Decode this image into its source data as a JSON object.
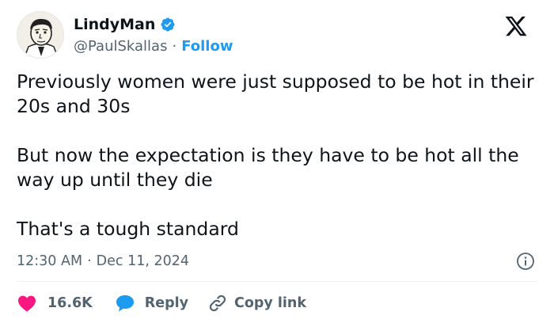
{
  "author": {
    "display_name": "LindyMan",
    "handle": "@PaulSkallas",
    "separator": "·",
    "follow_label": "Follow",
    "verified": true
  },
  "tweet": {
    "paragraphs": [
      "Previously women were just supposed to be hot in their 20s and 30s",
      "But now the expectation is they have to be hot all the way up until they die",
      "That's a tough standard"
    ]
  },
  "meta": {
    "time": "12:30 AM",
    "separator": "·",
    "date": "Dec 11, 2024"
  },
  "actions": {
    "likes_count": "16.6K",
    "reply_label": "Reply",
    "copy_link_label": "Copy link"
  },
  "colors": {
    "accent": "#1d9bf0",
    "like": "#f91880",
    "text": "#0f1419",
    "muted": "#536471"
  },
  "icons": {
    "verified": "verified-badge-icon",
    "logo": "x-logo-icon",
    "info": "info-icon",
    "like": "heart-icon",
    "reply": "speech-bubble-icon",
    "copy": "link-icon"
  }
}
